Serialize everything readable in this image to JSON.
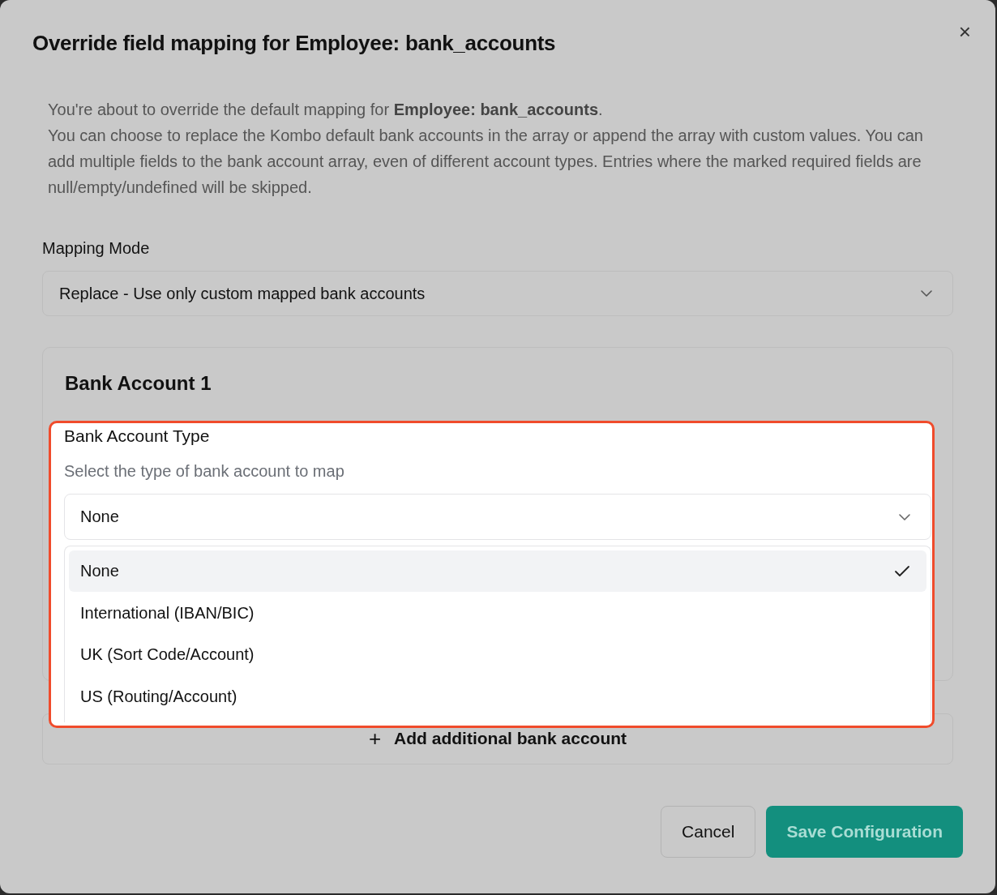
{
  "dialog": {
    "title": "Override field mapping for Employee: bank_accounts",
    "close": "×"
  },
  "description": [
    "You're about to override the default mapping for **Employee: bank_accounts**.",
    "You can choose to replace the Kombo default bank accounts in the array or append the array with custom values. You can add multiple fields to the bank account array, even of different account types. Entries where the marked required fields are null/empty/undefined will be skipped."
  ],
  "mapping_mode": {
    "label": "Mapping Mode",
    "value": "Replace - Use only custom mapped bank accounts"
  },
  "accounts": [
    {
      "title": "Bank Account 1",
      "type_field": {
        "label": "Bank Account Type",
        "hint": "Select the type of bank account to map",
        "value": "None",
        "expanded": true,
        "highlighted": true,
        "options": [
          {
            "label": "None",
            "selected": true
          },
          {
            "label": "International (IBAN/BIC)",
            "selected": false
          },
          {
            "label": "UK (Sort Code/Account)",
            "selected": false
          },
          {
            "label": "US (Routing/Account)",
            "selected": false
          }
        ]
      }
    }
  ],
  "add_button": {
    "icon": "+",
    "label": "Add additional bank account"
  },
  "buttons": [
    {
      "label": "Cancel",
      "kind": "secondary"
    },
    {
      "label": "Save Configuration",
      "kind": "primary"
    }
  ]
}
